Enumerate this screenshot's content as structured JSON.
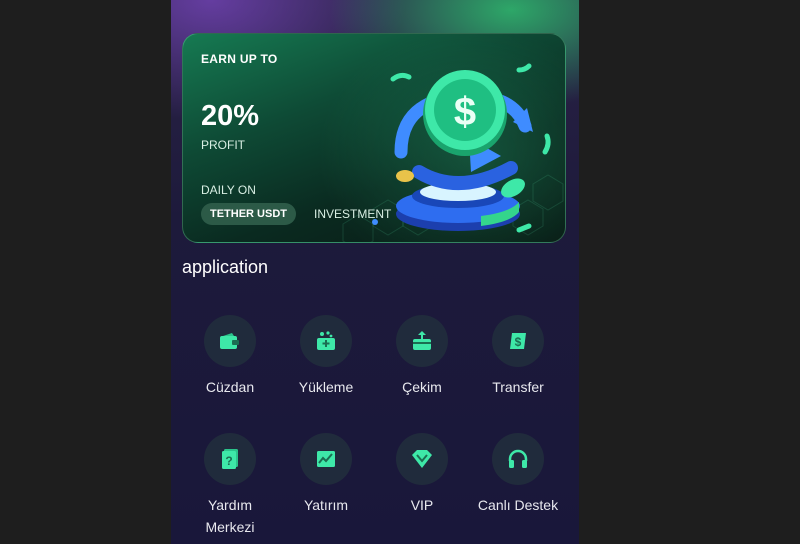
{
  "banner": {
    "earn": "EARN UP TO",
    "percent": "20%",
    "profit": "PROFIT",
    "daily": "DAILY ON",
    "pill": "TETHER USDT",
    "investment": "INVESTMENT",
    "icon": "dollar-coin-illustration"
  },
  "section_title": "application",
  "apps": [
    {
      "label": "Cüzdan",
      "icon": "wallet-icon"
    },
    {
      "label": "Yükleme",
      "icon": "deposit-icon"
    },
    {
      "label": "Çekim",
      "icon": "withdraw-icon"
    },
    {
      "label": "Transfer",
      "icon": "transfer-icon"
    },
    {
      "label": "Yardım Merkezi",
      "icon": "help-center-icon"
    },
    {
      "label": "Yatırım",
      "icon": "investment-chart-icon"
    },
    {
      "label": "VIP",
      "icon": "vip-diamond-icon"
    },
    {
      "label": "Canlı Destek",
      "icon": "headset-icon"
    }
  ],
  "colors": {
    "accent": "#3ee8a8",
    "icon_bg": "#202b3c"
  }
}
